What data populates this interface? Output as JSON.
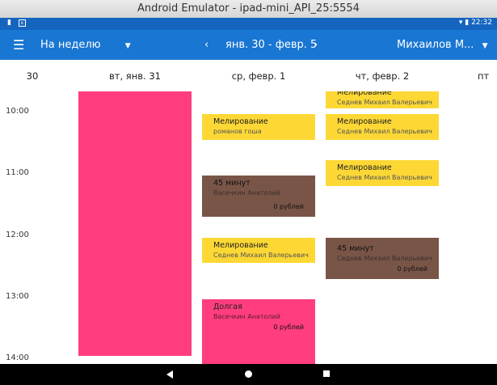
{
  "window": {
    "title": "Android Emulator - ipad-mini_API_25:5554"
  },
  "status_bar": {
    "time": "22:32",
    "bg_color": "#1565c0"
  },
  "app_bar": {
    "view_mode": "На неделю",
    "date_range": "янв. 30 - февр. 5",
    "user": "Михаилов М...",
    "bg_color": "#1976d2"
  },
  "days": {
    "mon_partial": "30",
    "tue": "вт, янв. 31",
    "wed": "ср, февр. 1",
    "thu": "чт, февр. 2",
    "fri_partial": "пт"
  },
  "times": {
    "t10": "10:00",
    "t11": "11:00",
    "t12": "12:00",
    "t13": "13:00",
    "t14": "14:00"
  },
  "colors": {
    "yellow": "#fdd835",
    "brown": "#795548",
    "pink": "#ff3d7f"
  },
  "events": {
    "wed": [
      {
        "title": "Мелирование",
        "person": "романов гоша"
      },
      {
        "title": "45 минут",
        "person": "Васечкин Анатолий",
        "price": "0 рублей"
      },
      {
        "title": "Мелирование",
        "person": "Седнев Михаил Валерьевич"
      },
      {
        "title": "Долгая",
        "person": "Васечкин Анатолий",
        "price": "0 рублей"
      }
    ],
    "thu": [
      {
        "title": "Мелирование",
        "person": "Седнев Михаил Валерьевич"
      },
      {
        "title": "Мелирование",
        "person": "Седнев Михаил Валерьевич"
      },
      {
        "title": "Мелирование",
        "person": "Седнев Михаил Валерьевич"
      },
      {
        "title": "45 минут",
        "person": "Седнев Михаил Валерьевич",
        "price": "0 рублей"
      }
    ]
  }
}
